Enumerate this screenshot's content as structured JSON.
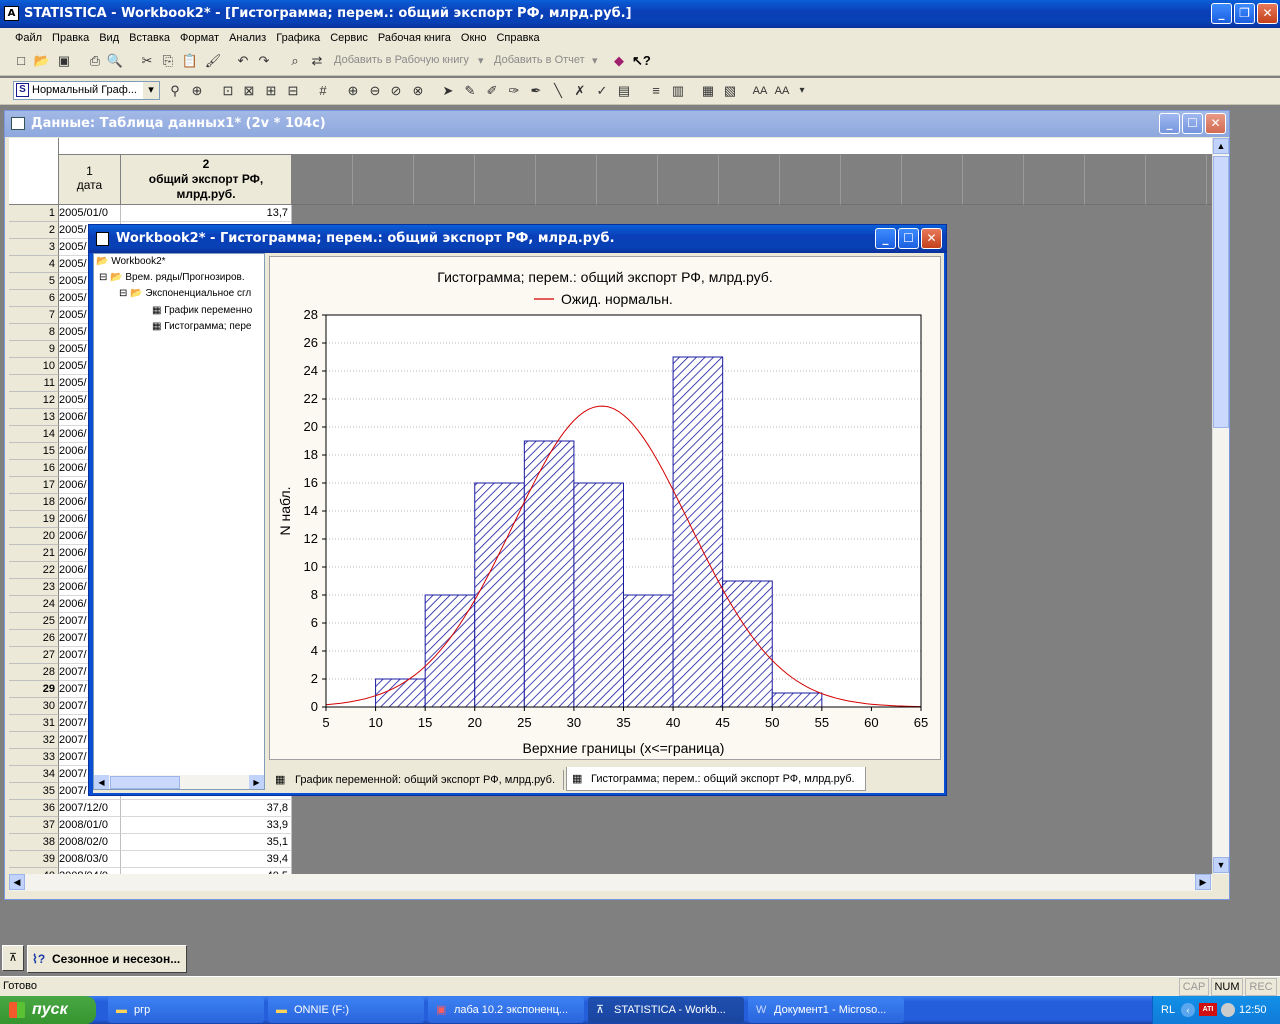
{
  "app": {
    "title": "STATISTICA - Workbook2* - [Гистограмма; перем.: общий экспорт РФ, млрд.руб.]",
    "menu": [
      "Файл",
      "Правка",
      "Вид",
      "Вставка",
      "Формат",
      "Анализ",
      "Графика",
      "Сервис",
      "Рабочая книга",
      "Окно",
      "Справка"
    ],
    "toolbar": {
      "add_workbook": "Добавить в Рабочую книгу",
      "add_report": "Добавить в Отчет",
      "graph_style": "Нормальный Граф..."
    }
  },
  "data_window": {
    "title": "Данные: Таблица данных1* (2v * 104c)",
    "col1_num": "1",
    "col1_name": "дата",
    "col2_num": "2",
    "col2_name": "общий экспорт РФ, млрд.руб.",
    "rows": [
      {
        "n": "1",
        "date": "2005/01/0",
        "val": "13,7"
      },
      {
        "n": "2",
        "date": "2005/",
        "val": ""
      },
      {
        "n": "3",
        "date": "2005/",
        "val": ""
      },
      {
        "n": "4",
        "date": "2005/",
        "val": ""
      },
      {
        "n": "5",
        "date": "2005/",
        "val": ""
      },
      {
        "n": "6",
        "date": "2005/",
        "val": ""
      },
      {
        "n": "7",
        "date": "2005/",
        "val": ""
      },
      {
        "n": "8",
        "date": "2005/",
        "val": ""
      },
      {
        "n": "9",
        "date": "2005/",
        "val": ""
      },
      {
        "n": "10",
        "date": "2005/",
        "val": ""
      },
      {
        "n": "11",
        "date": "2005/",
        "val": ""
      },
      {
        "n": "12",
        "date": "2005/",
        "val": ""
      },
      {
        "n": "13",
        "date": "2006/",
        "val": ""
      },
      {
        "n": "14",
        "date": "2006/",
        "val": ""
      },
      {
        "n": "15",
        "date": "2006/",
        "val": ""
      },
      {
        "n": "16",
        "date": "2006/",
        "val": ""
      },
      {
        "n": "17",
        "date": "2006/",
        "val": ""
      },
      {
        "n": "18",
        "date": "2006/",
        "val": ""
      },
      {
        "n": "19",
        "date": "2006/",
        "val": ""
      },
      {
        "n": "20",
        "date": "2006/",
        "val": ""
      },
      {
        "n": "21",
        "date": "2006/",
        "val": ""
      },
      {
        "n": "22",
        "date": "2006/",
        "val": ""
      },
      {
        "n": "23",
        "date": "2006/",
        "val": ""
      },
      {
        "n": "24",
        "date": "2006/",
        "val": ""
      },
      {
        "n": "25",
        "date": "2007/",
        "val": ""
      },
      {
        "n": "26",
        "date": "2007/",
        "val": ""
      },
      {
        "n": "27",
        "date": "2007/",
        "val": ""
      },
      {
        "n": "28",
        "date": "2007/",
        "val": ""
      },
      {
        "n": "29",
        "date": "2007/",
        "val": ""
      },
      {
        "n": "30",
        "date": "2007/",
        "val": ""
      },
      {
        "n": "31",
        "date": "2007/",
        "val": ""
      },
      {
        "n": "32",
        "date": "2007/",
        "val": ""
      },
      {
        "n": "33",
        "date": "2007/",
        "val": ""
      },
      {
        "n": "34",
        "date": "2007/",
        "val": ""
      },
      {
        "n": "35",
        "date": "2007/",
        "val": ""
      },
      {
        "n": "36",
        "date": "2007/12/0",
        "val": "37,8"
      },
      {
        "n": "37",
        "date": "2008/01/0",
        "val": "33,9"
      },
      {
        "n": "38",
        "date": "2008/02/0",
        "val": "35,1"
      },
      {
        "n": "39",
        "date": "2008/03/0",
        "val": "39,4"
      },
      {
        "n": "40",
        "date": "2008/04/0",
        "val": "40,5"
      }
    ]
  },
  "workbook": {
    "title": "Workbook2* - Гистограмма; перем.: общий экспорт РФ, млрд.руб.",
    "tree": [
      "Workbook2*",
      "Врем. ряды/Прогнозиров.",
      "Экспоненциальное сгл",
      "График переменно",
      "Гистограмма; пере"
    ],
    "tabs": [
      "График переменной: общий экспорт РФ, млрд.руб.",
      "Гистограмма; перем.: общий экспорт РФ, млрд.руб."
    ]
  },
  "chart_data": {
    "type": "bar",
    "title": "Гистограмма; перем.: общий экспорт РФ, млрд.руб.",
    "legend": "Ожид. нормальн.",
    "xlabel": "Верхние границы (x<=граница)",
    "ylabel": "N набл.",
    "x_ticks": [
      5,
      10,
      15,
      20,
      25,
      30,
      35,
      40,
      45,
      50,
      55,
      60,
      65
    ],
    "y_ticks": [
      0,
      2,
      4,
      6,
      8,
      10,
      12,
      14,
      16,
      18,
      20,
      22,
      24,
      26,
      28
    ],
    "xlim": [
      5,
      65
    ],
    "ylim": [
      0,
      28
    ],
    "bin_edges": [
      10,
      15,
      20,
      25,
      30,
      35,
      40,
      45,
      50,
      55
    ],
    "values": [
      2,
      8,
      16,
      19,
      16,
      8,
      25,
      9,
      1
    ],
    "normal_curve": {
      "mean": 32.8,
      "sd": 8.9,
      "peak": 21.5
    },
    "colors": {
      "bar_edge": "#1a1aa0",
      "hatch": "#1a1aa0",
      "curve": "#d40000"
    }
  },
  "sidebar_bottom": {
    "task_label": "Сезонное и несезон..."
  },
  "statusbar": {
    "text": "Готово",
    "cap": "CAP",
    "num": "NUM",
    "rec": "REC"
  },
  "taskbar": {
    "start": "пуск",
    "items": [
      "ргр",
      "ONNIE (F:)",
      "лаба 10.2 экспоненц...",
      "STATISTICA - Workb...",
      "Документ1 - Microso..."
    ],
    "lang": "RL",
    "clock": "12:50"
  }
}
